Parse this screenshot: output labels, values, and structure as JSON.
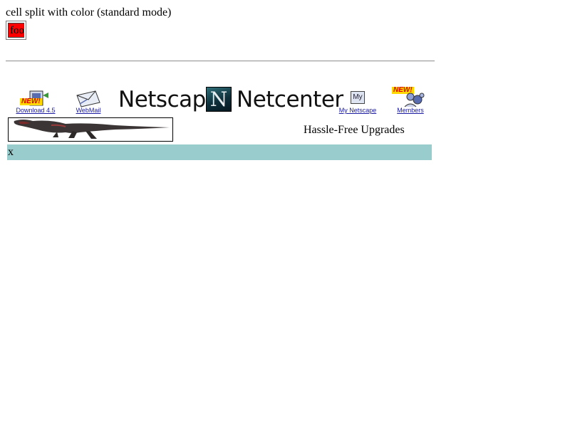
{
  "caption": "cell split with color (standard mode)",
  "foo_cell": {
    "text": "foo",
    "background": "#ff0000"
  },
  "nav": {
    "download": {
      "label": "Download 4.5",
      "badge": "NEW!",
      "icon": "download-box-icon"
    },
    "webmail": {
      "label": "WebMail",
      "icon": "webmail-envelope-icon"
    },
    "brand_left": "Netscape",
    "brand_logo_letter": "N",
    "brand_right": "Netcenter",
    "mynetscape": {
      "label": "My Netscape",
      "icon": "my-netscape-icon",
      "icon_text": "My"
    },
    "members": {
      "label": "Members",
      "badge": "NEW!",
      "icon": "members-icon"
    }
  },
  "banner": {
    "image": "dinosaur-banner-image",
    "text": "Hassle-Free Upgrades"
  },
  "bottom_bar": {
    "text": "x",
    "background": "#99cccc"
  }
}
